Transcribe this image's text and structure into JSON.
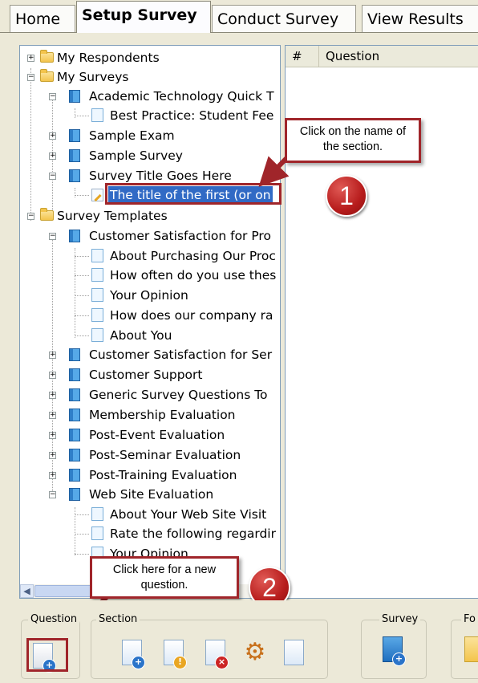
{
  "tabs": [
    {
      "label": "Home"
    },
    {
      "label": "Setup Survey",
      "active": true
    },
    {
      "label": "Conduct Survey"
    },
    {
      "label": "View Results"
    }
  ],
  "tree": {
    "items": [
      {
        "label": "My Respondents"
      },
      {
        "label": "My Surveys"
      },
      {
        "label": "Academic Technology Quick T"
      },
      {
        "label": "Best Practice: Student Fee"
      },
      {
        "label": "Sample Exam"
      },
      {
        "label": "Sample Survey"
      },
      {
        "label": "Survey Title Goes Here"
      },
      {
        "label": "The title of the first (or on"
      },
      {
        "label": "Survey Templates"
      },
      {
        "label": "Customer Satisfaction for Pro"
      },
      {
        "label": "About Purchasing Our Proc"
      },
      {
        "label": "How often do you use thes"
      },
      {
        "label": "Your Opinion"
      },
      {
        "label": "How does our company ra"
      },
      {
        "label": "About You"
      },
      {
        "label": "Customer Satisfaction for Ser"
      },
      {
        "label": "Customer Support"
      },
      {
        "label": "Generic Survey Questions To"
      },
      {
        "label": "Membership Evaluation"
      },
      {
        "label": "Post-Event Evaluation"
      },
      {
        "label": "Post-Seminar Evaluation"
      },
      {
        "label": "Post-Training Evaluation"
      },
      {
        "label": "Web Site Evaluation"
      },
      {
        "label": "About Your Web Site Visit"
      },
      {
        "label": "Rate the following regardir"
      },
      {
        "label": "Your Opinion"
      }
    ]
  },
  "grid": {
    "columns": [
      "#",
      "Question"
    ]
  },
  "callouts": {
    "section_text": "Click on the name of the section.",
    "section_number": "1",
    "question_text": "Click here for a new question.",
    "question_number": "2"
  },
  "toolbar": {
    "question_label": "Question",
    "section_label": "Section",
    "survey_label": "Survey",
    "fo_label": "Fo"
  },
  "colors": {
    "accent_red": "#a0252a",
    "selection_blue": "#316ac5"
  }
}
